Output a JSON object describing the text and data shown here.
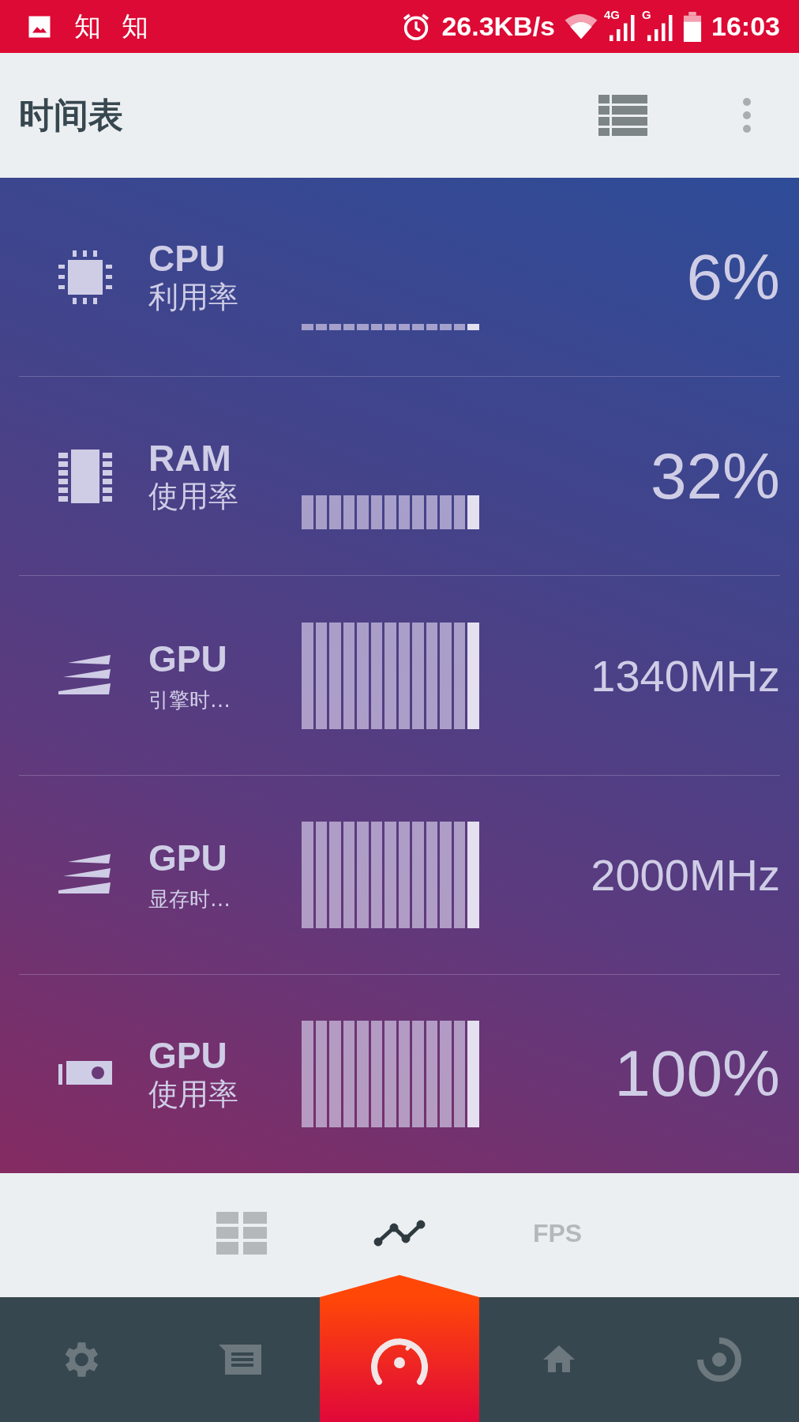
{
  "status_bar": {
    "notifications": [
      "知",
      "知"
    ],
    "speed": "26.3KB/s",
    "network_1": "4G",
    "network_2": "G",
    "time": "16:03"
  },
  "header": {
    "title": "时间表"
  },
  "meters": [
    {
      "kind": "cpu",
      "title": "CPU",
      "subtitle": "利用率",
      "value": "6%"
    },
    {
      "kind": "ram",
      "title": "RAM",
      "subtitle": "使用率",
      "value": "32%"
    },
    {
      "kind": "clock",
      "title": "GPU",
      "subtitle": "引擎时…",
      "value": "1340MHz"
    },
    {
      "kind": "clock",
      "title": "GPU",
      "subtitle": "显存时…",
      "value": "2000MHz"
    },
    {
      "kind": "gpu",
      "title": "GPU",
      "subtitle": "使用率",
      "value": "100%"
    }
  ],
  "tabs": [
    {
      "kind": "grid",
      "selected": false
    },
    {
      "kind": "chart",
      "selected": true
    },
    {
      "kind": "text",
      "label": "FPS",
      "selected": false
    }
  ],
  "nav": [
    {
      "kind": "settings",
      "selected": false
    },
    {
      "kind": "message",
      "selected": false
    },
    {
      "kind": "gauge",
      "selected": true
    },
    {
      "kind": "home",
      "selected": false
    },
    {
      "kind": "target",
      "selected": false
    }
  ]
}
